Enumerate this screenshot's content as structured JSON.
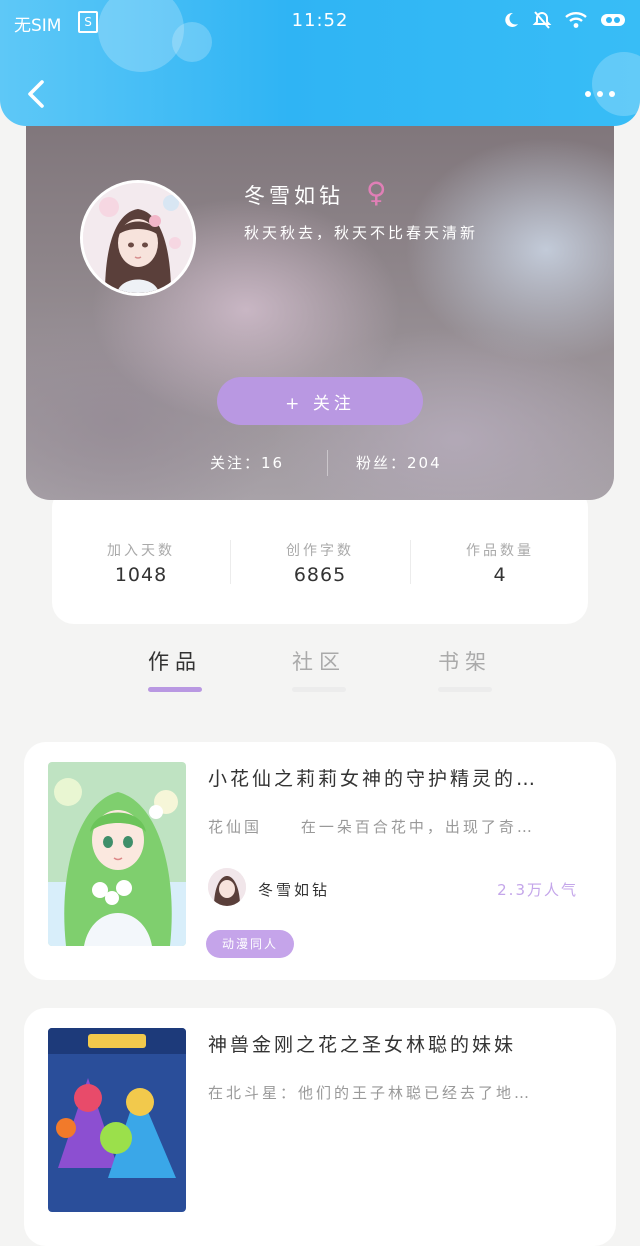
{
  "status_bar": {
    "sim": "无SIM",
    "sim_badge": "S",
    "time": "11:52"
  },
  "header": {
    "back_icon": "chevron-left-icon",
    "more_icon": "more-horizontal-icon"
  },
  "profile": {
    "name": "冬雪如钻",
    "gender_symbol": "♀",
    "bio": "秋天秋去，秋天不比春天清新",
    "follow_label": "+ 关注",
    "following_text": "关注：16",
    "fans_text": "粉丝：204"
  },
  "stats": [
    {
      "label": "加入天数",
      "value": "1048"
    },
    {
      "label": "创作字数",
      "value": "6865"
    },
    {
      "label": "作品数量",
      "value": "4"
    }
  ],
  "tabs": [
    {
      "label": "作品",
      "active": true
    },
    {
      "label": "社区",
      "active": false
    },
    {
      "label": "书架",
      "active": false
    }
  ],
  "works": [
    {
      "title": "小花仙之莉莉女神的守护精灵的…",
      "desc": "花仙国     在一朵百合花中，出现了奇…",
      "author": "冬雪如钻",
      "popularity": "2.3万人气",
      "tag": "动漫同人"
    },
    {
      "title": "神兽金刚之花之圣女林聪的妹妹",
      "desc": "在北斗星：他们的王子林聪已经去了地…"
    }
  ],
  "colors": {
    "accent": "#b998e2",
    "header": "#2fb4f4",
    "popularity": "#c4a6ea",
    "gender": "#e07fb6"
  }
}
